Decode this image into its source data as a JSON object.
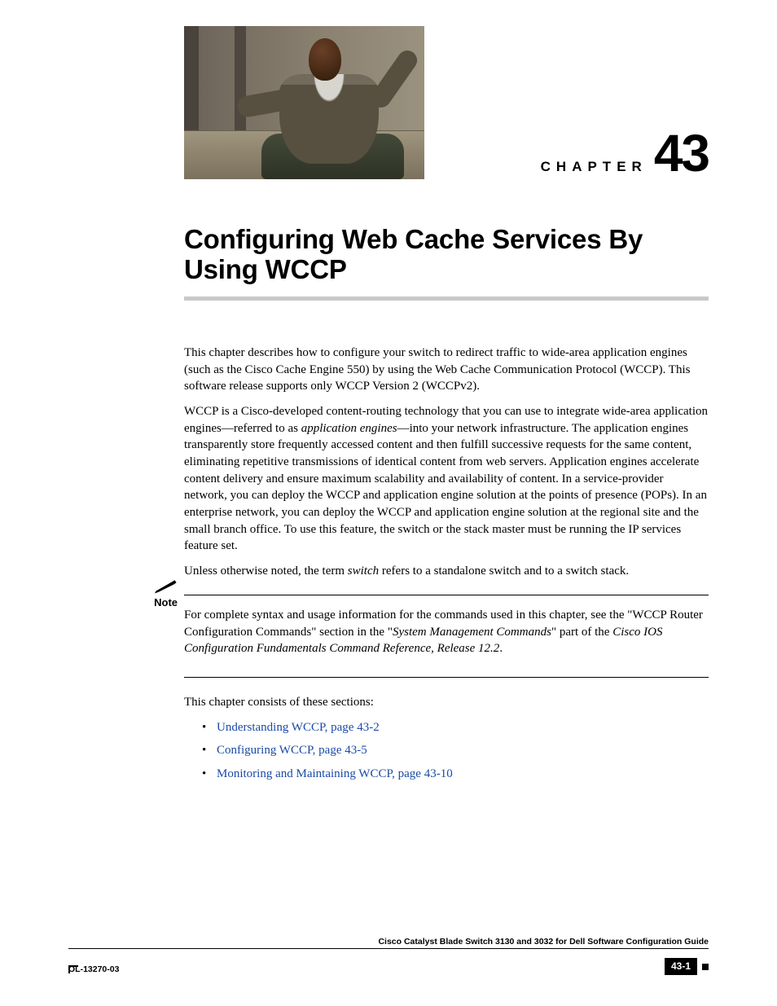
{
  "chapter": {
    "label": "CHAPTER",
    "number": "43",
    "title": "Configuring Web Cache Services By Using WCCP"
  },
  "paragraphs": {
    "p1": "This chapter describes how to configure your switch to redirect traffic to wide-area application engines (such as the Cisco Cache Engine 550) by using the Web Cache Communication Protocol (WCCP). This software release supports only WCCP Version 2 (WCCPv2).",
    "p2_a": "WCCP is a Cisco-developed content-routing technology that you can use to integrate wide-area application engines—referred to as ",
    "p2_em": "application engines",
    "p2_b": "—into your network infrastructure. The application engines transparently store frequently accessed content and then fulfill successive requests for the same content, eliminating repetitive transmissions of identical content from web servers. Application engines accelerate content delivery and ensure maximum scalability and availability of content. In a service-provider network, you can deploy the WCCP and application engine solution at the points of presence (POPs). In an enterprise network, you can deploy the WCCP and application engine solution at the regional site and the small branch office. To use this feature, the switch or the stack master must be running the IP services feature set.",
    "p3_a": "Unless otherwise noted, the term ",
    "p3_em": "switch",
    "p3_b": " refers to a standalone switch and to a switch stack."
  },
  "note": {
    "label": "Note",
    "t1": "For complete syntax and usage information for the commands used in this chapter, see the \"WCCP Router Configuration Commands\" section in the \"",
    "em1": "System Management Commands",
    "t2": "\" part of the ",
    "em2": "Cisco IOS Configuration Fundamentals Command Reference, Release 12.2",
    "t3": "."
  },
  "sections_lead": "This chapter consists of these sections:",
  "toc": [
    "Understanding WCCP, page 43-2",
    "Configuring WCCP, page 43-5",
    "Monitoring and Maintaining WCCP, page 43-10"
  ],
  "footer": {
    "guide": "Cisco Catalyst Blade Switch 3130 and 3032 for Dell Software Configuration Guide",
    "doc_id": "OL-13270-03",
    "page": "43-1"
  }
}
